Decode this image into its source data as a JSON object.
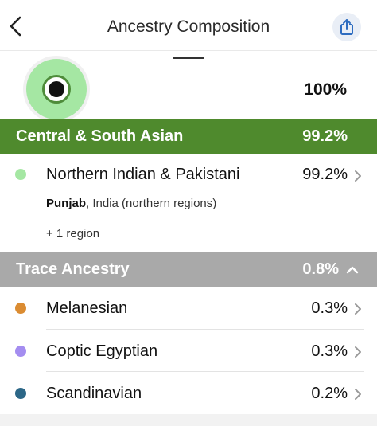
{
  "header": {
    "title": "Ancestry Composition"
  },
  "summary": {
    "total": "100%"
  },
  "groups": [
    {
      "name": "Central & South Asian",
      "percent": "99.2%",
      "color": "#4f8a2d",
      "items": [
        {
          "name": "Northern Indian & Pakistani",
          "percent": "99.2%",
          "color": "#a5e7a3",
          "region_bold": "Punjab",
          "region_rest": ", India (northern regions)",
          "more": "+ 1 region"
        }
      ]
    },
    {
      "name": "Trace Ancestry",
      "percent": "0.8%",
      "color": "#a9a9a9",
      "expanded": true,
      "items": [
        {
          "name": "Melanesian",
          "percent": "0.3%",
          "color": "#db8c32"
        },
        {
          "name": "Coptic Egyptian",
          "percent": "0.3%",
          "color": "#a48df0"
        },
        {
          "name": "Scandinavian",
          "percent": "0.2%",
          "color": "#2c6787"
        }
      ]
    }
  ],
  "icons": {
    "back": "chevron-left-icon",
    "share": "share-icon",
    "row_arrow": "chevron-right-icon",
    "collapse": "chevron-up-icon"
  }
}
